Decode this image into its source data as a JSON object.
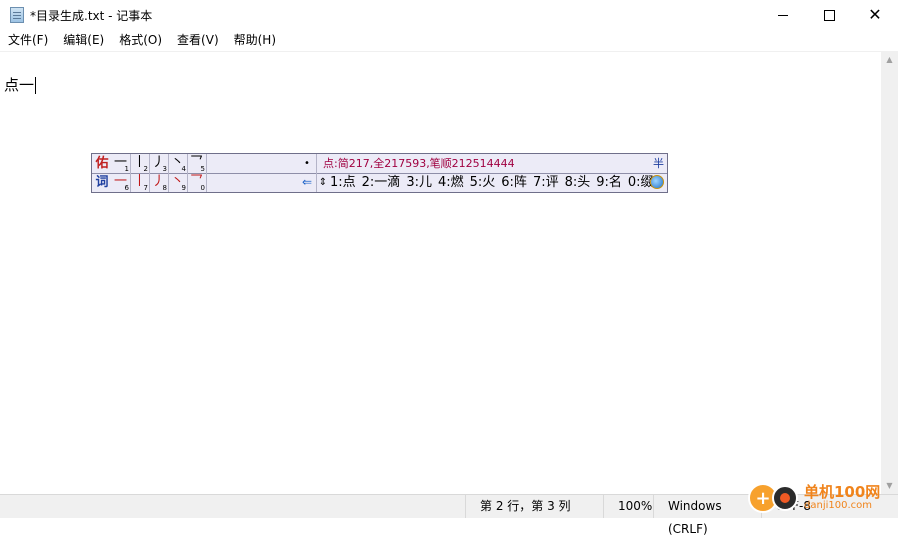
{
  "window": {
    "title": "*目录生成.txt - 记事本",
    "controls": {
      "minimize": "—",
      "maximize": "☐",
      "close": "✕"
    }
  },
  "menu": [
    {
      "label": "文件(F)"
    },
    {
      "label": "编辑(E)"
    },
    {
      "label": "格式(O)"
    },
    {
      "label": "查看(V)"
    },
    {
      "label": "帮助(H)"
    }
  ],
  "editor": {
    "text": "点一"
  },
  "ime": {
    "logo_top": "佑",
    "logo_bottom": "词",
    "strokes_top": [
      {
        "glyph": "一",
        "num": "1"
      },
      {
        "glyph": "丨",
        "num": "2"
      },
      {
        "glyph": "丿",
        "num": "3"
      },
      {
        "glyph": "丶",
        "num": "4"
      },
      {
        "glyph": "乛",
        "num": "5"
      }
    ],
    "strokes_bottom": [
      {
        "glyph": "一",
        "num": "6"
      },
      {
        "glyph": "丨",
        "num": "7"
      },
      {
        "glyph": "丿",
        "num": "8"
      },
      {
        "glyph": "丶",
        "num": "9"
      },
      {
        "glyph": "乛",
        "num": "0"
      }
    ],
    "dot": "•",
    "back_arrow": "⇐",
    "info": "点:简217,全217593,笔顺212514444",
    "half_width": "半",
    "page_arrows": "⇕",
    "candidates": [
      "1:点",
      "2:一滴",
      "3:儿",
      "4:燃",
      "5:火",
      "6:阵",
      "7:评",
      "8:头",
      "9:名",
      "0:缀"
    ]
  },
  "status": {
    "position": "第 2 行，第 3 列",
    "zoom": "100%",
    "line_ending": "Windows (CRLF)",
    "encoding": "UTF-8"
  },
  "watermark": {
    "cn": "单机100网",
    "en": "danji100.com"
  }
}
